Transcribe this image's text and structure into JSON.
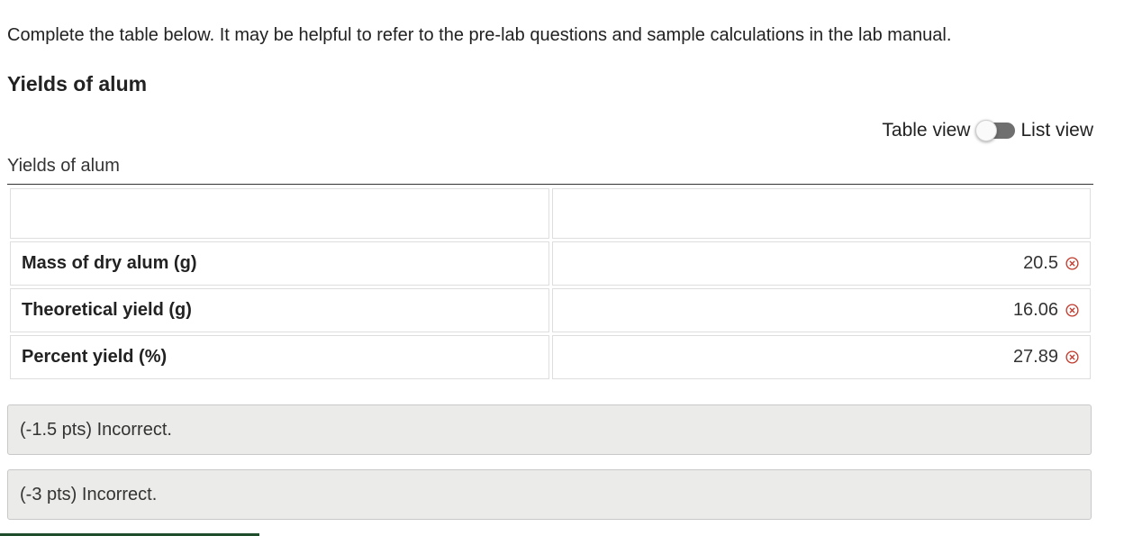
{
  "instructions": "Complete the table below. It may be helpful to refer to the pre-lab questions and sample calculations in the lab manual.",
  "section_title": "Yields of alum",
  "view_toggle": {
    "left_label": "Table view",
    "right_label": "List view",
    "state": "table"
  },
  "table": {
    "caption": "Yields of alum",
    "header": [
      "",
      ""
    ],
    "rows": [
      {
        "label": "Mass of dry alum (g)",
        "value": "20.5",
        "status_icon": "incorrect-icon"
      },
      {
        "label": "Theoretical yield (g)",
        "value": "16.06",
        "status_icon": "incorrect-icon"
      },
      {
        "label": "Percent yield (%)",
        "value": "27.89",
        "status_icon": "incorrect-icon"
      }
    ]
  },
  "feedback": [
    {
      "text": "(-1.5 pts) Incorrect."
    },
    {
      "text": "(-3 pts) Incorrect."
    }
  ],
  "colors": {
    "incorrect": "#c0392b",
    "toggle_track": "#6f6f6f",
    "feedback_bg": "#ebebe9",
    "bottom_accent": "#1e4d2b"
  }
}
